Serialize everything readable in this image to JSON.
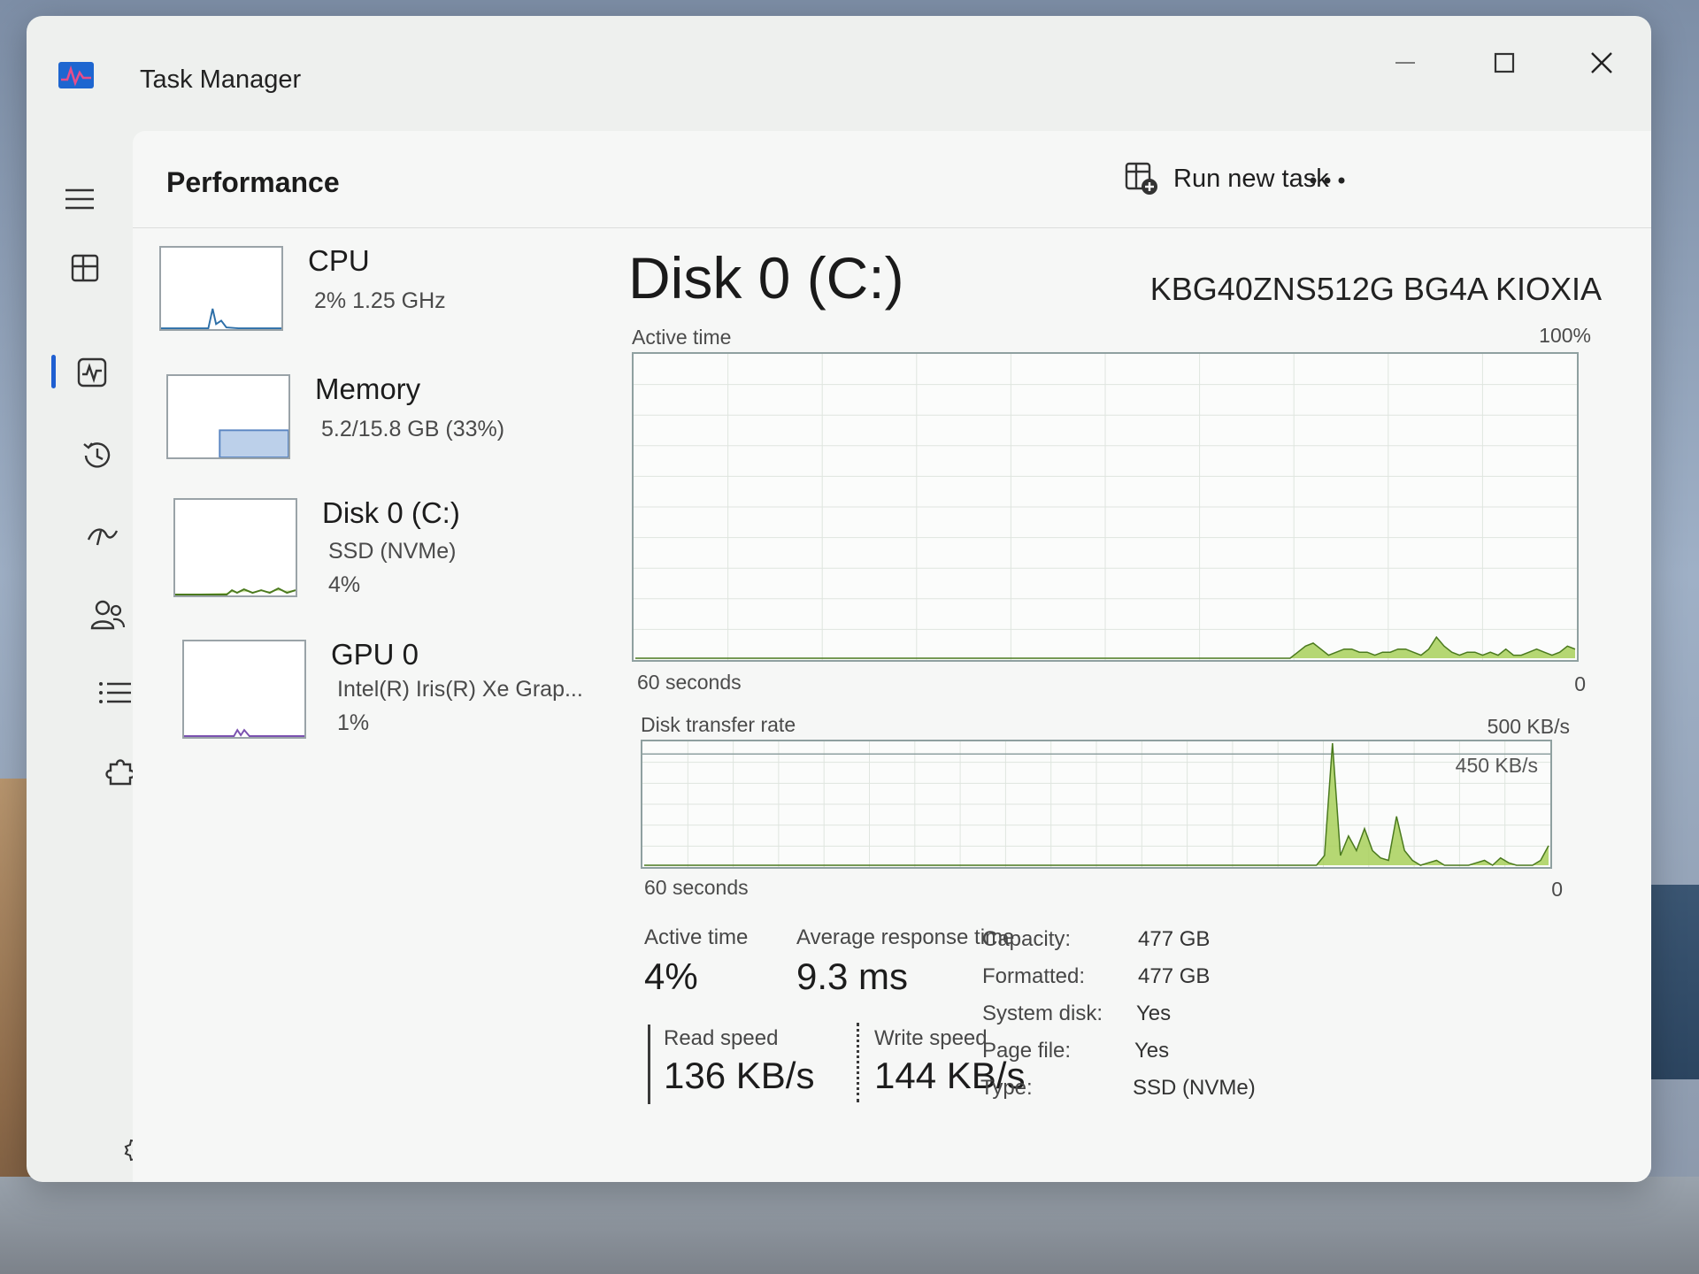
{
  "window": {
    "title": "Task Manager"
  },
  "header": {
    "page_title": "Performance",
    "run_new_task_label": "Run new task"
  },
  "devices": [
    {
      "name": "CPU",
      "line1": "2%  1.25 GHz",
      "line2": ""
    },
    {
      "name": "Memory",
      "line1": "5.2/15.8 GB (33%)",
      "line2": ""
    },
    {
      "name": "Disk 0 (C:)",
      "line1": "SSD (NVMe)",
      "line2": "4%"
    },
    {
      "name": "GPU 0",
      "line1": "Intel(R) Iris(R) Xe Grap...",
      "line2": "1%"
    }
  ],
  "detail": {
    "title": "Disk 0 (C:)",
    "model": "KBG40ZNS512G BG4A KIOXIA",
    "active_time_graph": {
      "label": "Active time",
      "max_label": "100%",
      "x_label": "60 seconds",
      "zero_label": "0"
    },
    "transfer_graph": {
      "label": "Disk transfer rate",
      "max_label": "500 KB/s",
      "inner_label": "450 KB/s",
      "x_label": "60 seconds",
      "zero_label": "0"
    },
    "stats": {
      "active_time_label": "Active time",
      "active_time_value": "4%",
      "avg_response_label": "Average response time",
      "avg_response_value": "9.3 ms",
      "read_speed_label": "Read speed",
      "read_speed_value": "136 KB/s",
      "write_speed_label": "Write speed",
      "write_speed_value": "144 KB/s"
    },
    "properties": [
      {
        "label": "Capacity:",
        "value": "477 GB"
      },
      {
        "label": "Formatted:",
        "value": "477 GB"
      },
      {
        "label": "System disk:",
        "value": "Yes"
      },
      {
        "label": "Page file:",
        "value": "Yes"
      },
      {
        "label": "Type:",
        "value": "SSD (NVMe)"
      }
    ]
  },
  "graph_series": {
    "active_time_percent": [
      0,
      0,
      0,
      0,
      0,
      0,
      0,
      0,
      0,
      0,
      0,
      0,
      0,
      0,
      0,
      0,
      0,
      0,
      0,
      0,
      0,
      0,
      0,
      0,
      0,
      0,
      0,
      0,
      0,
      0,
      0,
      0,
      0,
      0,
      0,
      0,
      0,
      0,
      0,
      0,
      0,
      0,
      0,
      0,
      0,
      0,
      0,
      0,
      0,
      0,
      0,
      0,
      0,
      0,
      0,
      0,
      0,
      0,
      0,
      0,
      0,
      0,
      0,
      0,
      0,
      0,
      0,
      0,
      0,
      0,
      0,
      0,
      0,
      0,
      0,
      0,
      0,
      0,
      0,
      0,
      0,
      0,
      0,
      0,
      0,
      0,
      2,
      4,
      5,
      3,
      1,
      2,
      3,
      3,
      2,
      2,
      1,
      2,
      2,
      3,
      3,
      2,
      1,
      3,
      7,
      4,
      2,
      1,
      2,
      2,
      1,
      2,
      1,
      3,
      1,
      1,
      2,
      3,
      2,
      1,
      2,
      4,
      3
    ],
    "transfer_rate_kbps": [
      0,
      0,
      0,
      0,
      0,
      0,
      0,
      0,
      0,
      0,
      0,
      0,
      0,
      0,
      0,
      0,
      0,
      0,
      0,
      0,
      0,
      0,
      0,
      0,
      0,
      0,
      0,
      0,
      0,
      0,
      0,
      0,
      0,
      0,
      0,
      0,
      0,
      0,
      0,
      0,
      0,
      0,
      0,
      0,
      0,
      0,
      0,
      0,
      0,
      0,
      0,
      0,
      0,
      0,
      0,
      0,
      0,
      0,
      0,
      0,
      0,
      0,
      0,
      0,
      0,
      0,
      0,
      0,
      0,
      0,
      0,
      0,
      0,
      0,
      0,
      0,
      0,
      0,
      0,
      0,
      0,
      0,
      0,
      0,
      0,
      40,
      500,
      40,
      120,
      60,
      150,
      60,
      30,
      20,
      200,
      60,
      20,
      0,
      10,
      20,
      0,
      0,
      0,
      0,
      10,
      20,
      0,
      30,
      10,
      0,
      0,
      0,
      20,
      80
    ]
  },
  "colors": {
    "accent": "#1f5fd1",
    "disk_green": "#a8d05a",
    "disk_line": "#4b7a1e",
    "grid": "#dfe5df"
  }
}
